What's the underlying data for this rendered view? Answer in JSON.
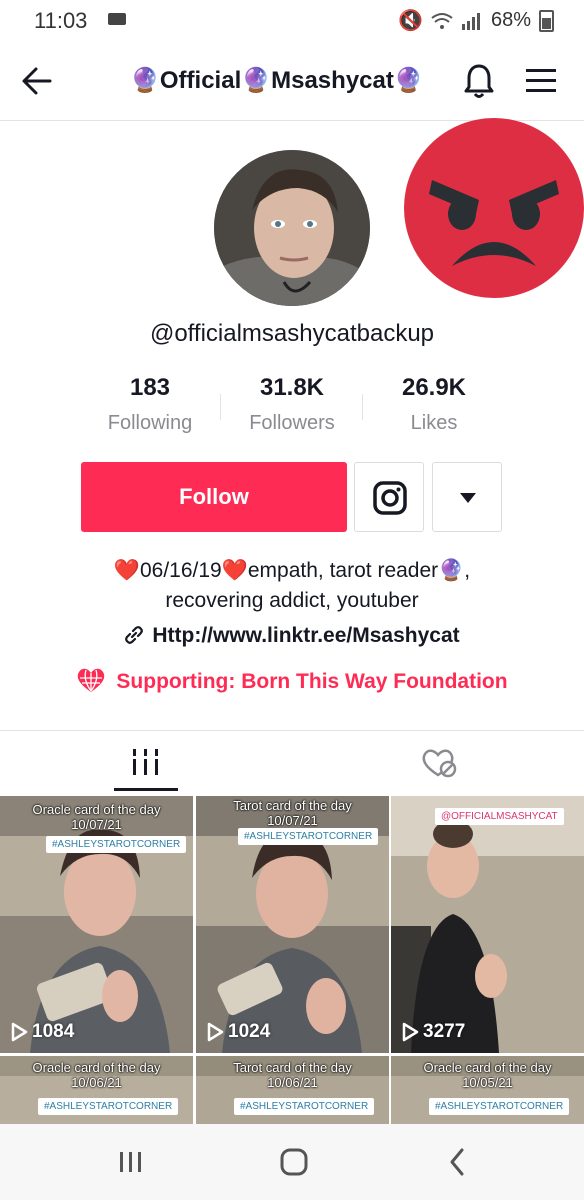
{
  "status_bar": {
    "time": "11:03",
    "battery": "68%"
  },
  "header": {
    "title": "🔮Official🔮Msashycat🔮"
  },
  "profile": {
    "username": "@officialmsashycatbackup",
    "stats": [
      {
        "value": "183",
        "label": "Following"
      },
      {
        "value": "31.8K",
        "label": "Followers"
      },
      {
        "value": "26.9K",
        "label": "Likes"
      }
    ],
    "follow_label": "Follow",
    "bio_line1": "❤️06/16/19❤️empath, tarot reader🔮,",
    "bio_line2": "recovering addict, youtuber",
    "link": "Http://www.linktr.ee/Msashycat",
    "supporting": "Supporting: Born This Way Foundation"
  },
  "videos": [
    {
      "caption_line1": "Oracle card of the day",
      "caption_line2": "10/07/21",
      "tag": "#ASHLEYSTAROTCORNER",
      "views": "1084"
    },
    {
      "caption_line1": "Tarot card of the day",
      "caption_line2": "10/07/21",
      "tag": "#ASHLEYSTAROTCORNER",
      "views": "1024"
    },
    {
      "caption_line1": "",
      "caption_line2": "",
      "tag": "@OFFICIALMSASHYCAT",
      "views": "3277"
    },
    {
      "caption_line1": "Oracle card of the day",
      "caption_line2": "10/06/21",
      "tag": "#ASHLEYSTAROTCORNER",
      "views": ""
    },
    {
      "caption_line1": "Tarot card of the day",
      "caption_line2": "10/06/21",
      "tag": "#ASHLEYSTAROTCORNER",
      "views": ""
    },
    {
      "caption_line1": "Oracle card of the day",
      "caption_line2": "10/05/21",
      "tag": "#ASHLEYSTAROTCORNER",
      "views": ""
    }
  ],
  "colors": {
    "accent": "#fe2c55",
    "angry_emoji": "#dd2e44",
    "text": "#161823",
    "muted": "#8a8b91"
  }
}
